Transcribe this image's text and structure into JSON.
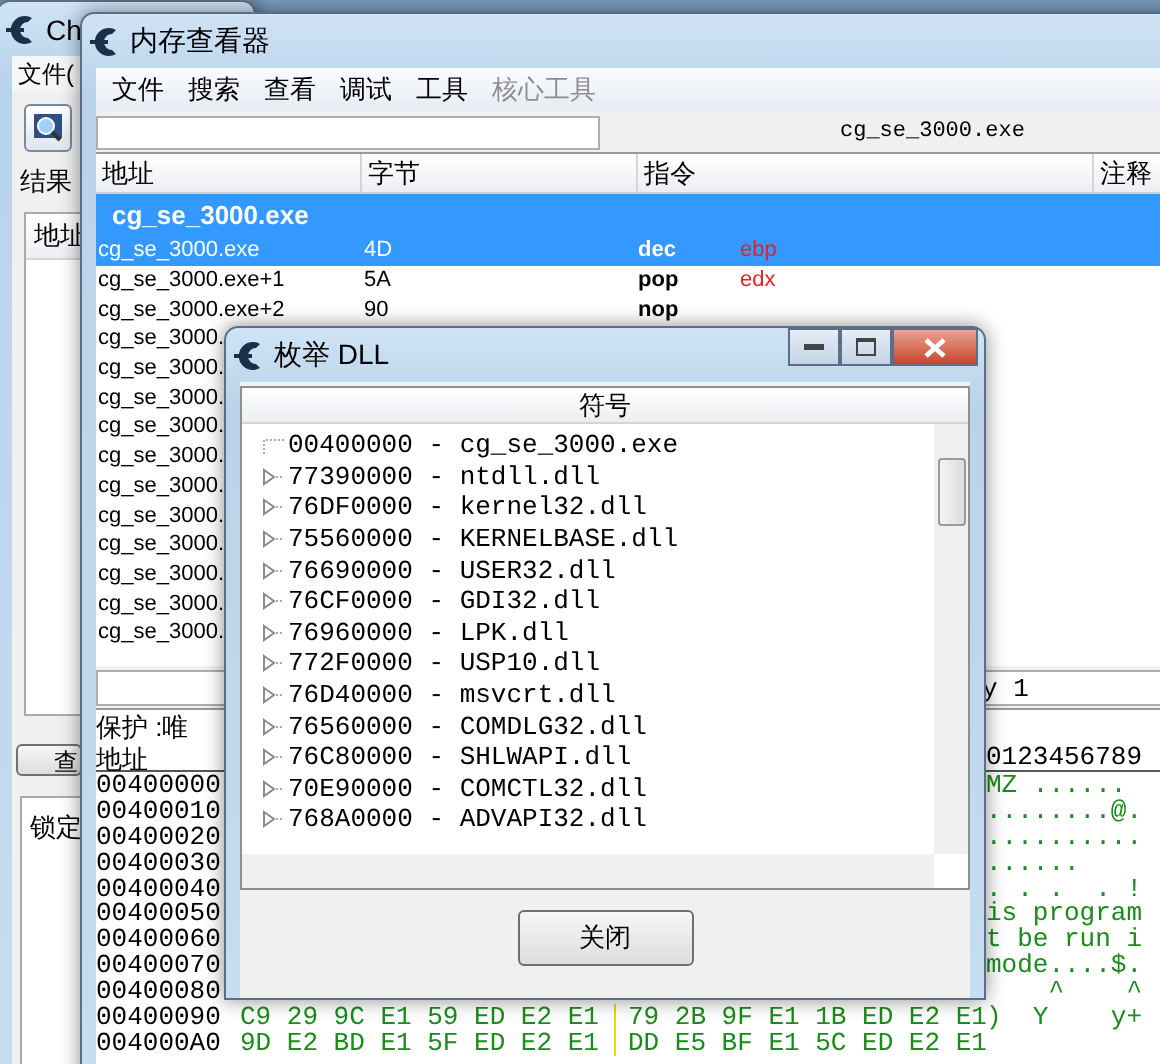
{
  "main_window": {
    "title": "Ch",
    "menu": [
      "文件("
    ],
    "results_label": "结果",
    "address_header": "地址",
    "view_button": "查",
    "lock_label": "锁定"
  },
  "memory_viewer": {
    "title": "内存查看器",
    "menu": [
      {
        "label": "文件",
        "disabled": false
      },
      {
        "label": "搜索",
        "disabled": false
      },
      {
        "label": "查看",
        "disabled": false
      },
      {
        "label": "调试",
        "disabled": false
      },
      {
        "label": "工具",
        "disabled": false
      },
      {
        "label": "核心工具",
        "disabled": true
      }
    ],
    "module_label": "cg_se_3000.exe",
    "columns": [
      "地址",
      "字节",
      "指令",
      "注释"
    ],
    "group_header": "cg_se_3000.exe",
    "rows": [
      {
        "address": "cg_se_3000.exe",
        "bytes": "4D",
        "opcode": "dec",
        "operand": "ebp",
        "selected": true
      },
      {
        "address": "cg_se_3000.exe+1",
        "bytes": "5A",
        "opcode": "pop",
        "operand": "edx",
        "selected": false
      },
      {
        "address": "cg_se_3000.exe+2",
        "bytes": "90",
        "opcode": "nop",
        "selected": false
      },
      {
        "address": "cg_se_3000.",
        "selected": false
      },
      {
        "address": "cg_se_3000.",
        "selected": false
      },
      {
        "address": "cg_se_3000.",
        "selected": false
      },
      {
        "address": "cg_se_3000.",
        "selected": false
      },
      {
        "address": "cg_se_3000.",
        "selected": false
      },
      {
        "address": "cg_se_3000.",
        "selected": false
      },
      {
        "address": "cg_se_3000.",
        "selected": false
      },
      {
        "address": "cg_se_3000.",
        "selected": false
      },
      {
        "address": "cg_se_3000.",
        "selected": false
      },
      {
        "address": "cg_se_3000.",
        "selected": false
      },
      {
        "address": "cg_se_3000.",
        "selected": false
      }
    ],
    "goto_value": "y 1",
    "protection": "保护 :唯",
    "hex_header": {
      "address": "地址",
      "ascii": "0123456789"
    },
    "hex_rows": [
      {
        "address": "00400000",
        "ascii": "MZ ......"
      },
      {
        "address": "00400010",
        "ascii": "........@."
      },
      {
        "address": "00400020",
        "ascii": ".........."
      },
      {
        "address": "00400030",
        "ascii": "......"
      },
      {
        "address": "00400040",
        "ascii": ". . .  . !"
      },
      {
        "address": "00400050",
        "ascii": "is program"
      },
      {
        "address": "00400060",
        "ascii": "t be run i"
      },
      {
        "address": "00400070",
        "ascii": "mode....$."
      },
      {
        "address": "00400080",
        "ascii": "    ^    ^"
      },
      {
        "address": "00400090",
        "bytes": [
          "C9 29 9C E1 59 ED E2 E1",
          "79 2B 9F E1 1B ED E2 E1"
        ],
        "ascii": ")  Y    y+"
      },
      {
        "address": "004000A0",
        "bytes": [
          "9D E2 BD E1 5F ED E2 E1",
          "DD E5 BF E1 5C ED E2 E1"
        ]
      }
    ]
  },
  "dll_dialog": {
    "title": "枚举 DLL",
    "column": "符号",
    "items": [
      {
        "text": "00400000 - cg_se_3000.exe",
        "expandable": false
      },
      {
        "text": "77390000 - ntdll.dll",
        "expandable": true
      },
      {
        "text": "76DF0000 - kernel32.dll",
        "expandable": true
      },
      {
        "text": "75560000 - KERNELBASE.dll",
        "expandable": true
      },
      {
        "text": "76690000 - USER32.dll",
        "expandable": true
      },
      {
        "text": "76CF0000 - GDI32.dll",
        "expandable": true
      },
      {
        "text": "76960000 - LPK.dll",
        "expandable": true
      },
      {
        "text": "772F0000 - USP10.dll",
        "expandable": true
      },
      {
        "text": "76D40000 - msvcrt.dll",
        "expandable": true
      },
      {
        "text": "76560000 - COMDLG32.dll",
        "expandable": true
      },
      {
        "text": "76C80000 - SHLWAPI.dll",
        "expandable": true
      },
      {
        "text": "70E90000 - COMCTL32.dll",
        "expandable": true
      },
      {
        "text": "768A0000 - ADVAPI32.dll",
        "expandable": true
      }
    ],
    "close_button": "关闭"
  }
}
